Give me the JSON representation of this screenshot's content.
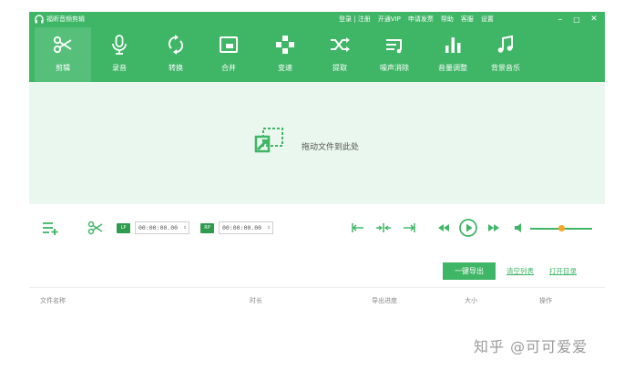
{
  "app": {
    "title": "福昕音频剪辑"
  },
  "top_links": [
    "登录 | 注册",
    "开通VIP",
    "申请发票",
    "帮助",
    "客服",
    "设置"
  ],
  "window_controls": {
    "minimize": "–",
    "maximize": "□",
    "close": "✕"
  },
  "toolbar": {
    "active": 0,
    "items": [
      {
        "label": "剪辑",
        "icon": "scissors-icon"
      },
      {
        "label": "录音",
        "icon": "microphone-icon"
      },
      {
        "label": "转换",
        "icon": "convert-arrows-icon"
      },
      {
        "label": "合并",
        "icon": "merge-window-icon"
      },
      {
        "label": "变速",
        "icon": "speed-dots-icon"
      },
      {
        "label": "提取",
        "icon": "shuffle-icon"
      },
      {
        "label": "噪声消除",
        "icon": "noise-lines-icon"
      },
      {
        "label": "音量调整",
        "icon": "volume-bars-icon"
      },
      {
        "label": "背景音乐",
        "icon": "music-note-icon"
      }
    ]
  },
  "dropzone": {
    "text": "拖动文件到此处"
  },
  "controls": {
    "lp_label": "LP",
    "rp_label": "RP",
    "start_time": "00:00:00.00",
    "end_time": "00:00:00.00",
    "spin": "⇕",
    "volume_level": 0.5
  },
  "actions": {
    "export": "一键导出",
    "clear": "清空列表",
    "open_dir": "打开目录"
  },
  "table": {
    "columns": [
      "文件名称",
      "时长",
      "导出进度",
      "大小",
      "操作"
    ]
  },
  "watermark": "知乎 @可可爱爱",
  "colors": {
    "brand": "#3fb566",
    "active_tab": "#56c07a",
    "drop_bg": "#eaf7ee",
    "slider_thumb": "#f5a623"
  }
}
